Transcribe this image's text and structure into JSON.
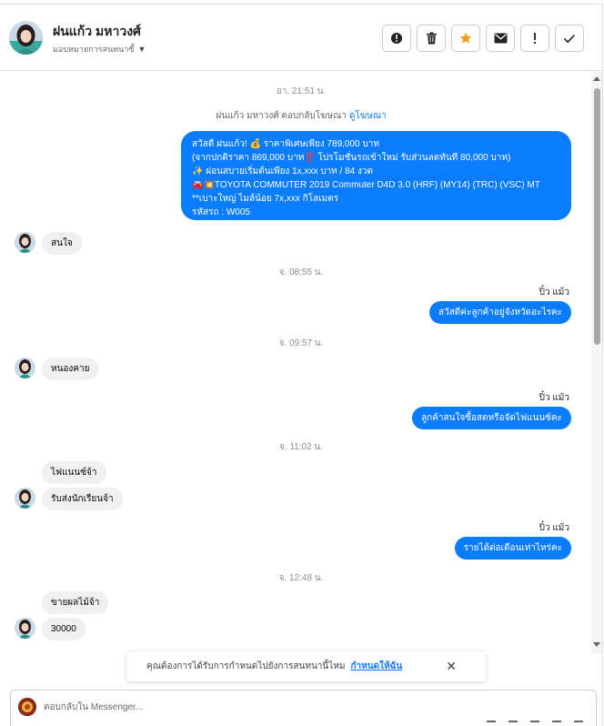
{
  "header": {
    "name": "ฝนแก้ว มหาวงศ์",
    "assign_label": "มอบหมายการสนทนาซี้",
    "buttons": [
      {
        "icon": "alert-circle-icon"
      },
      {
        "icon": "trash-icon"
      },
      {
        "icon": "star-icon",
        "color": "#f0a020"
      },
      {
        "icon": "envelope-icon"
      },
      {
        "icon": "exclamation-icon"
      },
      {
        "icon": "check-icon"
      }
    ]
  },
  "messages": {
    "ts1": "อา. 21:51 น.",
    "sys_text": "ฝนแก้ว มหาวงศ์ ตอบกลับโฆษณา",
    "sys_link": "ดูโฆษณา",
    "ad_lines": [
      "สวัสดี ฝนแก้ว! 💰 ราคาพิเศษเพียง 789,000 บาท",
      "(จากปกติราคา 869,000 บาท‼️ โปรโมชั่นรถเข้าใหม่ รับส่วนลดทันที 80,000 บาท)",
      "✨ ผ่อนสบายเริ่มต้นเพียง 1x,xxx บาท / 84 งวด",
      "🚘💥TOYOTA COMMUTER 2019 Commuter D4D 3.0 (HRF) (MY14) (TRC) (VSC) MT **เบาะใหญ่ ไมล์น้อย 7x,xxx กิโลเมตร",
      "รหัสรถ : W005"
    ],
    "in1": "สนใจ",
    "ts2": "จ. 08:55 น.",
    "sender1": "ปิ๋ว แม้ว",
    "out1": "สวัสดีค่ะลูกค้าอยู่จังหวัดอะไรคะ",
    "ts3": "จ. 09:57 น.",
    "in2": "หนองคาย",
    "sender2": "ปิ๋ว แม้ว",
    "out2": "ลูกค้าสนใจซื้อสดหรือจัดไฟแนนซ์คะ",
    "ts4": "จ. 11:02 น.",
    "in3a": "ไฟแนนซ์จ้า",
    "in3b": "รับส่งนักเรียนจ้า",
    "sender3": "ปิ๋ว แม้ว",
    "out3": "รายได้ต่อเดือนเท่าไหร่คะ",
    "ts5": "จ. 12:48 น.",
    "in4a": "ขายผลไม้จ้า",
    "in4b": "30000"
  },
  "notice": {
    "text": "คุณต้องการได้รับการกำหนดไปยังการสนทนานี้ไหม",
    "link": "กำหนดให้ฉัน",
    "close_icon": "close-icon"
  },
  "reply": {
    "placeholder": "ตอบกลับใน Messenger..."
  },
  "colors": {
    "accent": "#0a7cff",
    "incoming": "#f0f0f0",
    "link": "#1877f2",
    "star": "#f0a020"
  }
}
